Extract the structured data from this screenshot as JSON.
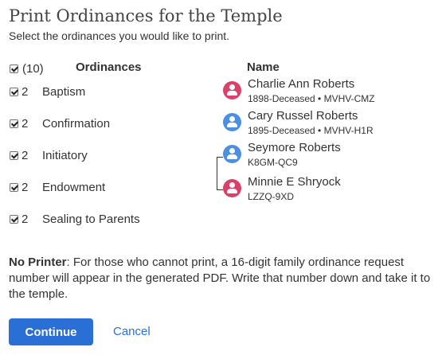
{
  "dialog": {
    "title": "Print Ordinances for the Temple",
    "subtitle": "Select the ordinances you would like to print."
  },
  "ordinances": {
    "select_all_count": "(10)",
    "header": "Ordinances",
    "items": [
      {
        "count": "2",
        "label": "Baptism",
        "checked": true
      },
      {
        "count": "2",
        "label": "Confirmation",
        "checked": true
      },
      {
        "count": "2",
        "label": "Initiatory",
        "checked": true
      },
      {
        "count": "2",
        "label": "Endowment",
        "checked": true
      },
      {
        "count": "2",
        "label": "Sealing to Parents",
        "checked": true
      }
    ]
  },
  "names": {
    "header": "Name",
    "people": [
      {
        "name": "Charlie Ann Roberts",
        "detail": "1898-Deceased • MVHV-CMZ",
        "icon": "female-person-icon",
        "color": "#d9416b"
      },
      {
        "name": "Cary Russel Roberts",
        "detail": "1895-Deceased • MVHV-H1R",
        "icon": "male-person-icon",
        "color": "#4a8fe0"
      },
      {
        "name": "Seymore Roberts",
        "detail": "K8GM-QC9",
        "icon": "male-person-icon",
        "color": "#4a8fe0"
      },
      {
        "name": "Minnie E Shryock",
        "detail": "LZZQ-9XD",
        "icon": "female-person-icon",
        "color": "#d9416b"
      }
    ]
  },
  "note": {
    "label": "No Printer",
    "text": ": For those who cannot print, a 16-digit family ordinance request number will appear in the generated PDF. Write that number down and take it to the temple."
  },
  "actions": {
    "continue_label": "Continue",
    "cancel_label": "Cancel",
    "primary_color": "#2a6fd6"
  }
}
